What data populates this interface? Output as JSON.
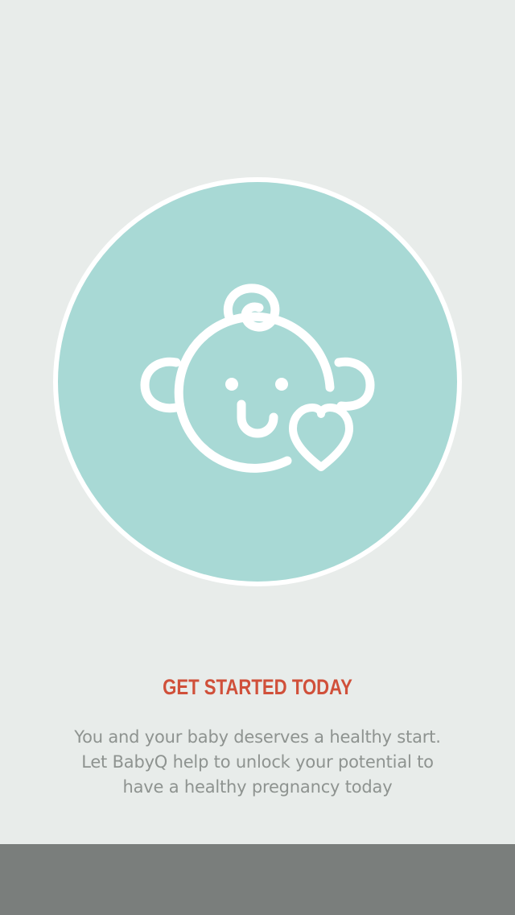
{
  "onboarding": {
    "headline": "GET STARTED TODAY",
    "body": "You and your baby deserves a healthy start.\nLet BabyQ help to unlock your potential to\nhave a healthy pregnancy today"
  },
  "icons": {
    "hero": "baby-face-icon",
    "accent": "heart-icon"
  },
  "colors": {
    "background": "#e8ecea",
    "circle_fill": "#a8d9d5",
    "circle_ring": "#ffffff",
    "headline": "#d0503a",
    "body_text": "#8e9390",
    "footer": "#7a7e7c"
  }
}
